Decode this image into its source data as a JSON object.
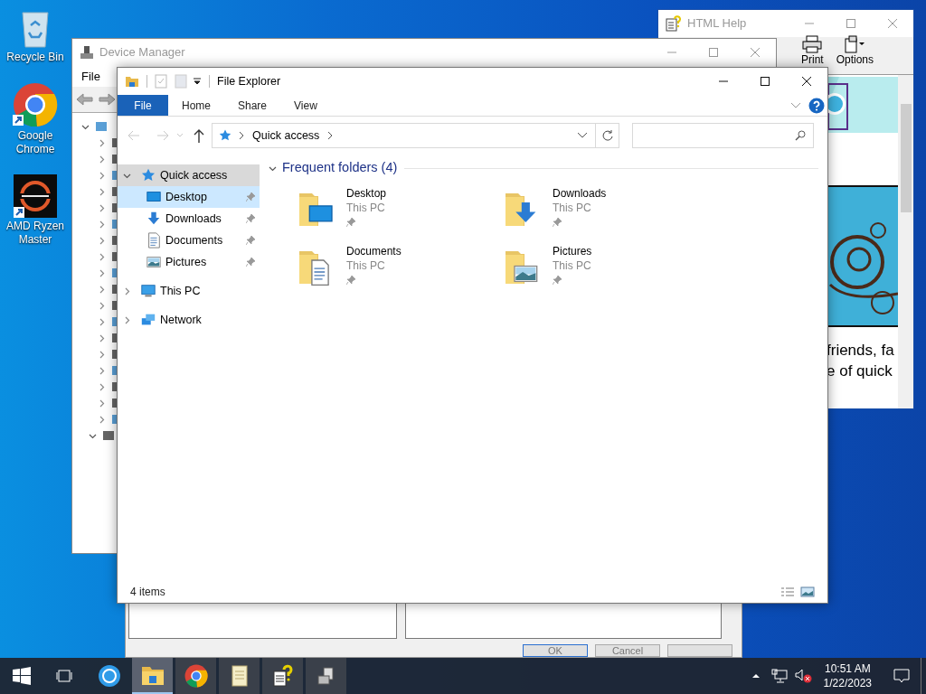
{
  "desktop_icons": [
    {
      "label": "Recycle Bin",
      "kind": "recycle"
    },
    {
      "label": "Google Chrome",
      "kind": "chrome"
    },
    {
      "label": "AMD Ryzen Master",
      "kind": "ryzen"
    }
  ],
  "html_help": {
    "title": "HTML Help",
    "toolbar": [
      {
        "label": "Print",
        "kind": "print"
      },
      {
        "label": "Options",
        "kind": "options"
      }
    ],
    "content_lines": [
      "friends, fa",
      "e of quick"
    ]
  },
  "device_manager": {
    "title": "Device Manager",
    "menu": [
      "File"
    ],
    "tree": [
      {
        "expanded": true
      },
      {
        "expanded": false
      },
      {
        "expanded": false
      },
      {
        "expanded": false
      },
      {
        "expanded": false
      },
      {
        "expanded": false
      },
      {
        "expanded": false
      },
      {
        "expanded": false
      },
      {
        "expanded": false
      },
      {
        "expanded": false
      },
      {
        "expanded": false
      },
      {
        "expanded": false
      },
      {
        "expanded": false
      },
      {
        "expanded": false
      },
      {
        "expanded": false
      },
      {
        "expanded": false
      },
      {
        "expanded": false
      },
      {
        "expanded": false
      },
      {
        "expanded": false
      },
      {
        "expanded": true
      }
    ]
  },
  "dialog": {
    "buttons": [
      "OK",
      "Cancel"
    ]
  },
  "file_explorer": {
    "title": "File Explorer",
    "ribbon_tabs": [
      {
        "label": "File",
        "selected": true
      },
      {
        "label": "Home",
        "selected": false
      },
      {
        "label": "Share",
        "selected": false
      },
      {
        "label": "View",
        "selected": false
      }
    ],
    "address": "Quick access",
    "nav": [
      {
        "label": "Quick access",
        "kind": "star",
        "expanded": true,
        "hovered": true,
        "selected": false,
        "children": [
          {
            "label": "Desktop",
            "kind": "desktop",
            "pinned": true,
            "selected": true
          },
          {
            "label": "Downloads",
            "kind": "downloads",
            "pinned": true,
            "selected": false
          },
          {
            "label": "Documents",
            "kind": "documents",
            "pinned": true,
            "selected": false
          },
          {
            "label": "Pictures",
            "kind": "pictures",
            "pinned": true,
            "selected": false
          }
        ]
      },
      {
        "label": "This PC",
        "kind": "pc",
        "expanded": false,
        "hovered": false,
        "selected": false
      },
      {
        "label": "Network",
        "kind": "network",
        "expanded": false,
        "hovered": false,
        "selected": false
      }
    ],
    "section": {
      "title": "Frequent folders (4)",
      "expanded": true
    },
    "folders": [
      {
        "name": "Desktop",
        "location": "This PC",
        "kind": "desktop",
        "pinned": true
      },
      {
        "name": "Downloads",
        "location": "This PC",
        "kind": "downloads",
        "pinned": true
      },
      {
        "name": "Documents",
        "location": "This PC",
        "kind": "documents",
        "pinned": true
      },
      {
        "name": "Pictures",
        "location": "This PC",
        "kind": "pictures",
        "pinned": true
      }
    ],
    "status": "4 items"
  },
  "taskbar": {
    "apps": [
      {
        "kind": "circle",
        "selected": false
      },
      {
        "kind": "explorer",
        "selected": true
      },
      {
        "kind": "chrome",
        "selected": false
      },
      {
        "kind": "notepad",
        "selected": false
      },
      {
        "kind": "help",
        "selected": false
      },
      {
        "kind": "devices",
        "selected": false
      }
    ],
    "time": "10:51 AM",
    "date": "1/22/2023"
  }
}
